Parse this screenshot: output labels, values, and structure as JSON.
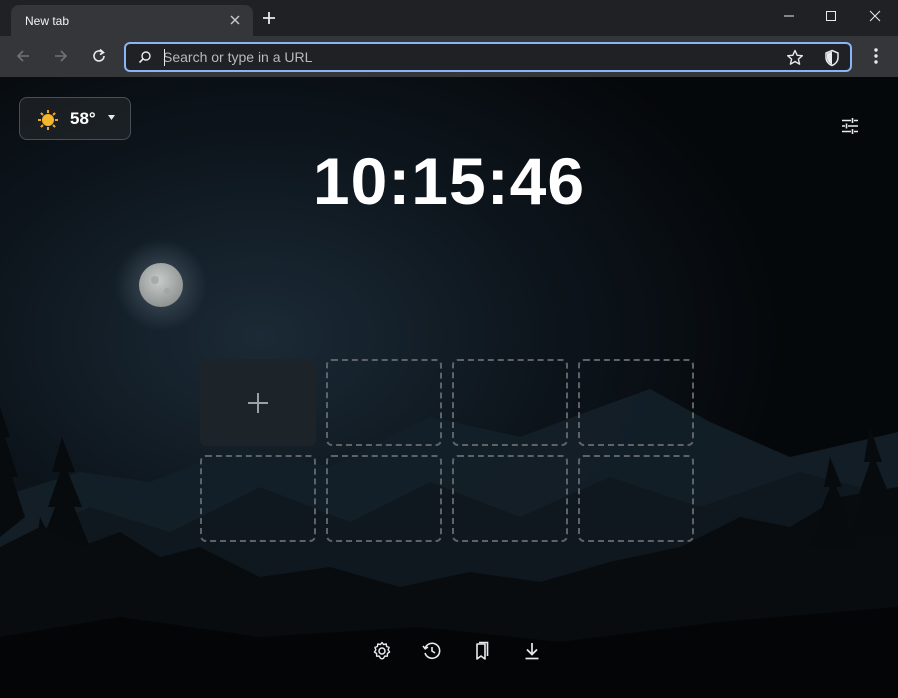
{
  "tab": {
    "title": "New tab"
  },
  "omnibox": {
    "placeholder": "Search or type in a URL",
    "value": ""
  },
  "weather": {
    "temperature": "58°",
    "icon": "sun-icon"
  },
  "clock": {
    "time": "10:15:46"
  },
  "tiles": {
    "add_icon": "plus-icon",
    "empty_count": 7
  },
  "bottom_bar": [
    "settings-icon",
    "history-icon",
    "bookmarks-icon",
    "downloads-icon"
  ],
  "colors": {
    "accent": "#8ab4f8",
    "toolbar": "#35363a",
    "titlebar": "#202124",
    "background": "#05080b"
  }
}
